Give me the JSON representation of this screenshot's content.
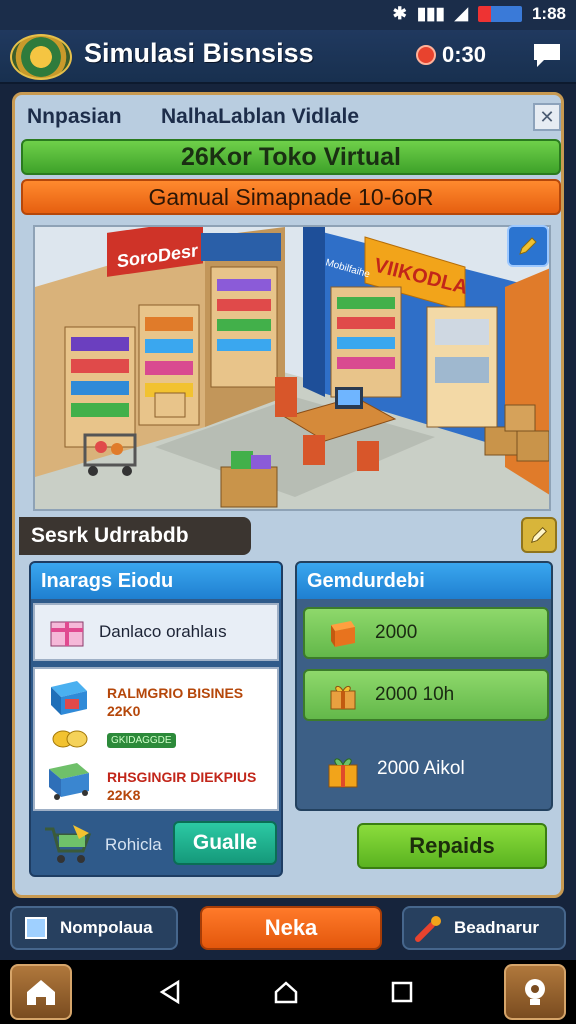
{
  "status_bar": {
    "time": "1:88"
  },
  "header": {
    "title": "Simulasi Bisnsiss",
    "timer": "0:30"
  },
  "tabs": {
    "left": "Nnpasian",
    "right": "NalhaLablan Vidlale"
  },
  "banners": {
    "green": "26Kor Toko Virtual",
    "orange": "Gamual Simapnade 10-6oR"
  },
  "scene": {
    "signs": {
      "left_shop": "SoroDesr",
      "right_shop": "VIIKODLA",
      "blue_shop": "Mobilfaihe"
    }
  },
  "section": {
    "title": "Sesrk Udrrabdb"
  },
  "left_card": {
    "header": "Inarags Eiodu",
    "item_label": "Danlaco orahlaıs",
    "list": [
      {
        "title": "RALMGRIO BISINES",
        "value": "22K0"
      },
      {
        "tag": "GKIDAGGDE"
      },
      {
        "title": "RHSGINGIR DIEKPIUS",
        "value": "22K8"
      }
    ],
    "footer_label": "Rohicla",
    "action_button": "Gualle"
  },
  "right_card": {
    "header": "Gemdurdebi",
    "rewards": [
      "2000",
      "2000 10h",
      "2000 Aikol"
    ],
    "action_button": "Repaids"
  },
  "bottom_nav": {
    "left": "Nompolaua",
    "middle": "Neka",
    "right": "Beadnarur"
  }
}
